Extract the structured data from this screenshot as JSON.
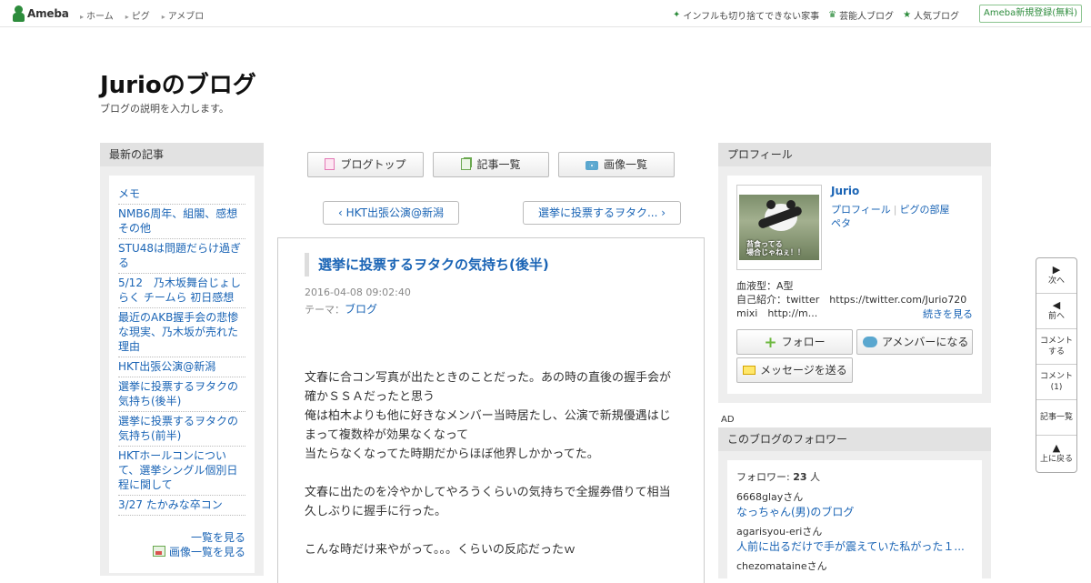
{
  "header": {
    "logo_text": "Ameba",
    "nav": [
      "ホーム",
      "ピグ",
      "アメブロ"
    ],
    "right_links": [
      {
        "label": "インフルも切り捨てできない家事",
        "icon": "sparkle-icon"
      },
      {
        "label": "芸能人ブログ",
        "icon": "crown-icon"
      },
      {
        "label": "人気ブログ",
        "icon": "star-icon"
      }
    ],
    "register_label": "Ameba新規登録(無料)"
  },
  "blog": {
    "title": "Jurioのブログ",
    "description": "ブログの説明を入力します。"
  },
  "left": {
    "heading": "最新の記事",
    "recent": [
      "メモ",
      "NMB6周年、組閣、感想その他",
      "STU48は問題だらけ過ぎる",
      "5/12　乃木坂舞台じょしらく チームら 初日感想",
      "最近のAKB握手会の悲惨な現実、乃木坂が売れた理由",
      "HKT出張公演@新潟",
      "選挙に投票するヲタクの気持ち(後半)",
      "選挙に投票するヲタクの気持ち(前半)",
      "HKTホールコンについて、選挙シングル個別日程に関して",
      "3/27 たかみな卒コン"
    ],
    "view_all": "一覧を見る",
    "view_images": "画像一覧を見る"
  },
  "center": {
    "nav_buttons": [
      "ブログトップ",
      "記事一覧",
      "画像一覧"
    ],
    "prev_label": "HKT出張公演@新潟",
    "next_label": "選挙に投票するヲタク...",
    "article": {
      "title": "選挙に投票するヲタクの気持ち(後半)",
      "date": "2016-04-08 09:02:40",
      "theme_prefix": "テーマ：",
      "theme": "ブログ",
      "paragraphs": [
        "文春に合コン写真が出たときのことだった。あの時の直後の握手会が確かＳＳＡだったと思う\n俺は柏木よりも他に好きなメンバー当時居たし、公演で新規優遇はじまって複数枠が効果なくなって\n当たらなくなってた時期だからほぼ他界しかかってた。",
        "文春に出たのを冷やかしてやろうくらいの気持ちで全握券借りて相当久しぶりに握手に行った。",
        "こんな時だけ来やがって。。。くらいの反応だったｗ"
      ]
    }
  },
  "right": {
    "profile_heading": "プロフィール",
    "avatar_caption": "苔食ってる\n場合じゃねぇ！！",
    "name": "Jurio",
    "links": [
      "プロフィール",
      "ピグの部屋",
      "ペタ"
    ],
    "blood": "血液型：A型",
    "intro": "自己紹介：twitter　https://twitter.com/Jurio720",
    "intro2": "mixi　http://m...",
    "more": "続きを見る",
    "follow": "フォロー",
    "amember": "アメンバーになる",
    "message": "メッセージを送る",
    "ad": "AD",
    "followers_heading": "このブログのフォロワー",
    "followers_prefix": "フォロワー:",
    "followers_count": "23",
    "followers_suffix": "人",
    "followers": [
      {
        "name": "6668glayさん",
        "blog": "なっちゃん(男)のブログ"
      },
      {
        "name": "agarisyou-eriさん",
        "blog": "人前に出るだけで手が震えていた私がった１..."
      },
      {
        "name": "chezomataineさん",
        "blog": ""
      }
    ]
  },
  "float_nav": [
    "次へ",
    "前へ",
    "コメントする",
    "コメント(1)",
    "記事一覧",
    "上に戻る"
  ]
}
